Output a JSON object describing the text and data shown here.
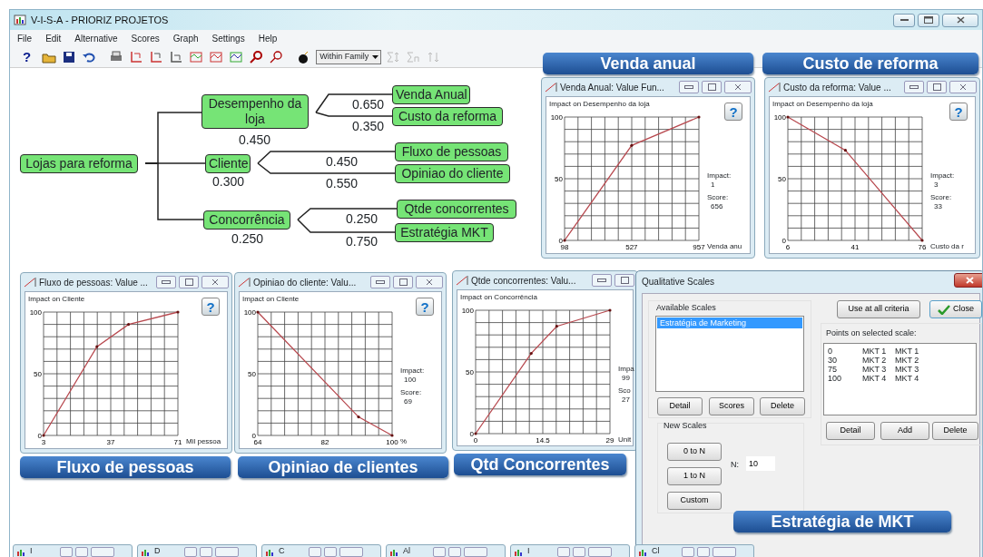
{
  "window": {
    "title": "V-I-S-A - PRIORIZ PROJETOS"
  },
  "menu": [
    "File",
    "Edit",
    "Alternative",
    "Scores",
    "Graph",
    "Settings",
    "Help"
  ],
  "toolbar": {
    "help": "?",
    "dropdown": "Within Family"
  },
  "tree": {
    "label": "Lojas para reforma",
    "children": [
      {
        "label": "Desempenho da loja",
        "weight": "0.450",
        "children": [
          {
            "label": "Venda Anual",
            "weight": "0.650"
          },
          {
            "label": "Custo da reforma",
            "weight": "0.350"
          }
        ]
      },
      {
        "label": "Cliente",
        "weight": "0.300",
        "children": [
          {
            "label": "Fluxo de pessoas",
            "weight": "0.450"
          },
          {
            "label": "Opiniao do cliente",
            "weight": "0.550"
          }
        ]
      },
      {
        "label": "Concorrência",
        "weight": "0.250",
        "children": [
          {
            "label": "Qtde concorrentes",
            "weight": "0.250"
          },
          {
            "label": "Estratégia MKT",
            "weight": "0.750"
          }
        ]
      }
    ]
  },
  "value_windows": [
    {
      "title": "Venda Anual: Value Fun...",
      "help": "?",
      "impact_label": "Impact:",
      "impact": "1",
      "score_label": "Score:",
      "score": "656",
      "chart_data": {
        "type": "line",
        "ylabel": "Impact on Desempenho da loja",
        "xlabel": "Venda anu",
        "x": [
          98,
          527,
          957
        ],
        "series": [
          {
            "color": "#b84a50",
            "values": [
              0,
              77,
              100
            ]
          }
        ],
        "xticks": [
          98,
          527,
          957
        ],
        "yticks": [
          0,
          50,
          100
        ],
        "xlim": [
          98,
          957
        ],
        "ylim": [
          0,
          100
        ]
      }
    },
    {
      "title": "Custo da reforma: Value ...",
      "help": "?",
      "impact_label": "Impact:",
      "impact": "3",
      "score_label": "Score:",
      "score": "33",
      "chart_data": {
        "type": "line",
        "ylabel": "Impact on Desempenho da loja",
        "xlabel": "Custo da r",
        "x": [
          6,
          36,
          76
        ],
        "series": [
          {
            "color": "#b84a50",
            "values": [
              100,
              73,
              0
            ]
          }
        ],
        "xticks": [
          6,
          41,
          76
        ],
        "yticks": [
          0,
          50,
          100
        ],
        "xlim": [
          6,
          76
        ],
        "ylim": [
          0,
          100
        ]
      }
    },
    {
      "title": "Fluxo de pessoas: Value ...",
      "help": "?",
      "chart_data": {
        "type": "line",
        "ylabel": "Impact on Cliente",
        "xlabel": "Mil pessoa",
        "x": [
          3,
          30,
          46,
          71
        ],
        "series": [
          {
            "color": "#b84a50",
            "values": [
              0,
              72,
              90,
              100
            ]
          }
        ],
        "xticks": [
          3,
          37,
          71
        ],
        "yticks": [
          0,
          50,
          100
        ],
        "xlim": [
          3,
          71
        ],
        "ylim": [
          0,
          100
        ]
      }
    },
    {
      "title": "Opiniao do cliente: Valu...",
      "help": "?",
      "impact_label": "Impact:",
      "impact": "100",
      "score_label": "Score:",
      "score": "69",
      "chart_data": {
        "type": "line",
        "ylabel": "Impact on Cliente",
        "xlabel": "%",
        "x": [
          64,
          91,
          100
        ],
        "series": [
          {
            "color": "#b84a50",
            "values": [
              100,
              15,
              0
            ]
          }
        ],
        "xticks": [
          64,
          82,
          100
        ],
        "yticks": [
          0,
          50,
          100
        ],
        "xlim": [
          64,
          100
        ],
        "ylim": [
          0,
          100
        ]
      }
    },
    {
      "title": "Qtde concorrentes: Valu...",
      "impact_label": "Impa",
      "impact": "99",
      "score_label": "Sco",
      "score": "27",
      "chart_data": {
        "type": "line",
        "ylabel": "Impact on Concorrência",
        "xlabel": "Unit",
        "x": [
          0,
          12,
          17.5,
          29
        ],
        "series": [
          {
            "color": "#b84a50",
            "values": [
              0,
              65,
              87,
              100
            ]
          }
        ],
        "xticks": [
          0,
          14.5,
          29
        ],
        "yticks": [
          0,
          50,
          100
        ],
        "xlim": [
          0,
          29
        ],
        "ylim": [
          0,
          100
        ]
      }
    }
  ],
  "callouts": [
    "Venda anual",
    "Custo de reforma",
    "Fluxo de pessoas",
    "Opiniao de clientes",
    "Qtd Concorrentes",
    "Estratégia de MKT"
  ],
  "dialog": {
    "title": "Qualitative Scales",
    "available_label": "Available Scales",
    "scales": [
      {
        "label": "Estratégia de Marketing",
        "selected": true
      }
    ],
    "scale_buttons": [
      "Detail",
      "Scores",
      "Delete"
    ],
    "new_scales_label": "New Scales",
    "new_buttons": [
      "0 to N",
      "1 to N",
      "Custom"
    ],
    "n_label": "N:",
    "n_value": "10",
    "use_all_button": "Use at all criteria",
    "close_button": "Close",
    "points_label": "Points on selected scale:",
    "points": [
      [
        "0",
        "MKT 1",
        "MKT 1"
      ],
      [
        "30",
        "MKT 2",
        "MKT 2"
      ],
      [
        "75",
        "MKT 3",
        "MKT 3"
      ],
      [
        "100",
        "MKT 4",
        "MKT 4"
      ]
    ],
    "point_buttons": [
      "Detail",
      "Add",
      "Delete"
    ]
  },
  "minimized_windows": [
    "I",
    "D",
    "C",
    "Al",
    "I",
    "Cl"
  ]
}
